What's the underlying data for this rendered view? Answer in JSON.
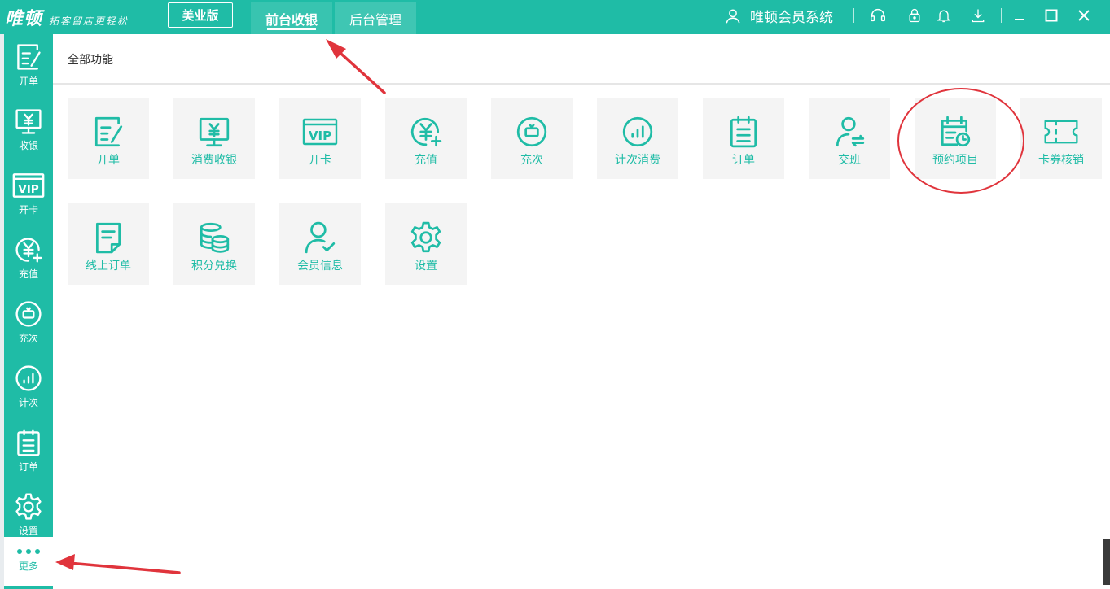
{
  "topbar": {
    "logo_main": "唯顿",
    "logo_sub": "拓客留店更轻松",
    "edition_label": "美业版",
    "tabs": [
      {
        "label": "前台收银",
        "active": true
      },
      {
        "label": "后台管理",
        "active": false
      }
    ],
    "system_name": "唯顿会员系统",
    "icons": [
      "user-icon",
      "headset-icon",
      "lock-icon",
      "bell-icon",
      "download-icon",
      "minimize-icon",
      "maximize-icon",
      "close-icon"
    ]
  },
  "sidebar": {
    "items": [
      {
        "label": "开单",
        "icon": "edit-icon"
      },
      {
        "label": "收银",
        "icon": "monitor-yen-icon"
      },
      {
        "label": "开卡",
        "icon": "vip-card-icon"
      },
      {
        "label": "充值",
        "icon": "yen-plus-icon"
      },
      {
        "label": "充次",
        "icon": "recharge-times-icon"
      },
      {
        "label": "计次",
        "icon": "bar-chart-icon"
      },
      {
        "label": "订单",
        "icon": "clipboard-list-icon"
      },
      {
        "label": "设置",
        "icon": "gear-icon"
      }
    ],
    "more_label": "更多"
  },
  "main": {
    "section_title": "全部功能",
    "tiles": [
      {
        "label": "开单",
        "icon": "edit-icon"
      },
      {
        "label": "消费收银",
        "icon": "monitor-yen-icon"
      },
      {
        "label": "开卡",
        "icon": "vip-card-icon"
      },
      {
        "label": "充值",
        "icon": "yen-plus-icon"
      },
      {
        "label": "充次",
        "icon": "recharge-times-icon"
      },
      {
        "label": "计次消费",
        "icon": "bar-chart-icon"
      },
      {
        "label": "订单",
        "icon": "clipboard-list-icon"
      },
      {
        "label": "交班",
        "icon": "user-shift-icon"
      },
      {
        "label": "预约项目",
        "icon": "calendar-clock-icon"
      },
      {
        "label": "卡券核销",
        "icon": "ticket-icon"
      },
      {
        "label": "线上订单",
        "icon": "document-icon"
      },
      {
        "label": "积分兑换",
        "icon": "coins-icon"
      },
      {
        "label": "会员信息",
        "icon": "user-check-icon"
      },
      {
        "label": "设置",
        "icon": "gear-icon"
      }
    ]
  },
  "colors": {
    "brand": "#1fbca6",
    "tile_bg": "#f4f4f4",
    "annotation": "#e0343c"
  }
}
